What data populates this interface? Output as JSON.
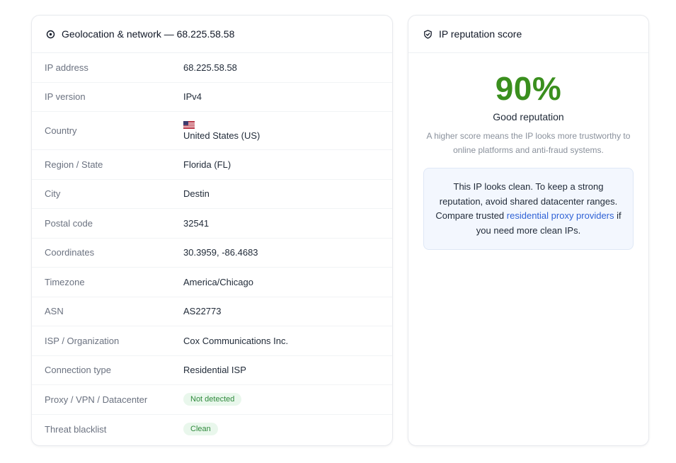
{
  "geo": {
    "title": "Geolocation & network — 68.225.58.58",
    "icon": "location-pin-icon",
    "rows": [
      {
        "key": "IP address",
        "value": "68.225.58.58"
      },
      {
        "key": "IP version",
        "value": "IPv4"
      },
      {
        "key": "Country",
        "value": "United States (US)",
        "flag": "us-flag-icon"
      },
      {
        "key": "Region / State",
        "value": "Florida (FL)"
      },
      {
        "key": "City",
        "value": "Destin"
      },
      {
        "key": "Postal code",
        "value": "32541"
      },
      {
        "key": "Coordinates",
        "value": "30.3959, -86.4683"
      },
      {
        "key": "Timezone",
        "value": "America/Chicago"
      },
      {
        "key": "ASN",
        "value": "AS22773"
      },
      {
        "key": "ISP / Organization",
        "value": "Cox Communications Inc."
      },
      {
        "key": "Connection type",
        "value": "Residential ISP"
      },
      {
        "key": "Proxy / VPN / Datacenter",
        "value": "Not detected"
      },
      {
        "key": "Threat blacklist",
        "value": "Clean"
      }
    ]
  },
  "reputation": {
    "title": "IP reputation score",
    "icon": "shield-check-icon",
    "score": "90%",
    "label": "Good reputation",
    "description": "A higher score means the IP looks more trustworthy to online platforms and anti-fraud systems.",
    "note_before": "This IP looks clean. To keep a strong reputation, avoid shared datacenter ranges. Compare trusted ",
    "note_link": "residential proxy providers",
    "note_after": " if you need more clean IPs."
  },
  "colors": {
    "score": "#3a8f1e",
    "badge_bg": "#e9f7ec",
    "badge_text": "#2f8a3c",
    "link": "#2f62d6",
    "note_bg": "#f3f7fe"
  }
}
